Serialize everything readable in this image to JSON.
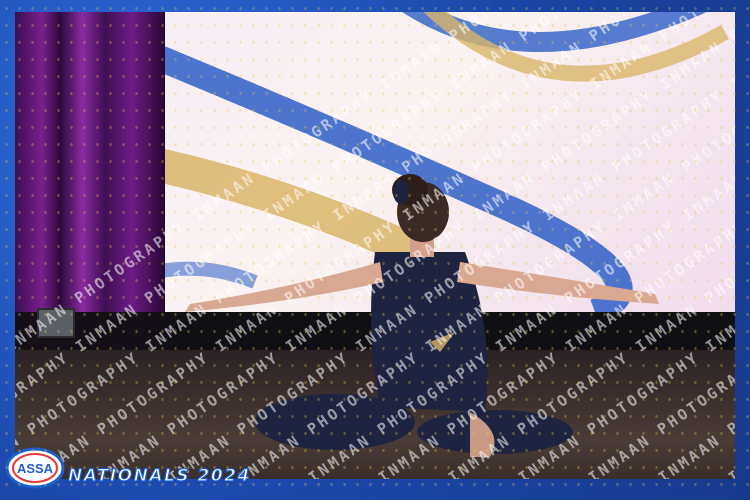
{
  "photo": {
    "subject": "dancer-seated-back-view",
    "costume_color": "#1e2340"
  },
  "watermark": {
    "text": "INMAAN PHOTOGRAPHY",
    "repeat_count": 14
  },
  "branding": {
    "logo_text": "ASSA",
    "event_title": "NATIONALS 2024"
  },
  "colors": {
    "frame_blue": "#1a46a8",
    "gold_glitter": "#e8c34a",
    "curtain_purple": "#7a1f8e",
    "screen_swoosh_blue": "#3a67c9",
    "screen_swoosh_gold": "#d9b56a"
  }
}
